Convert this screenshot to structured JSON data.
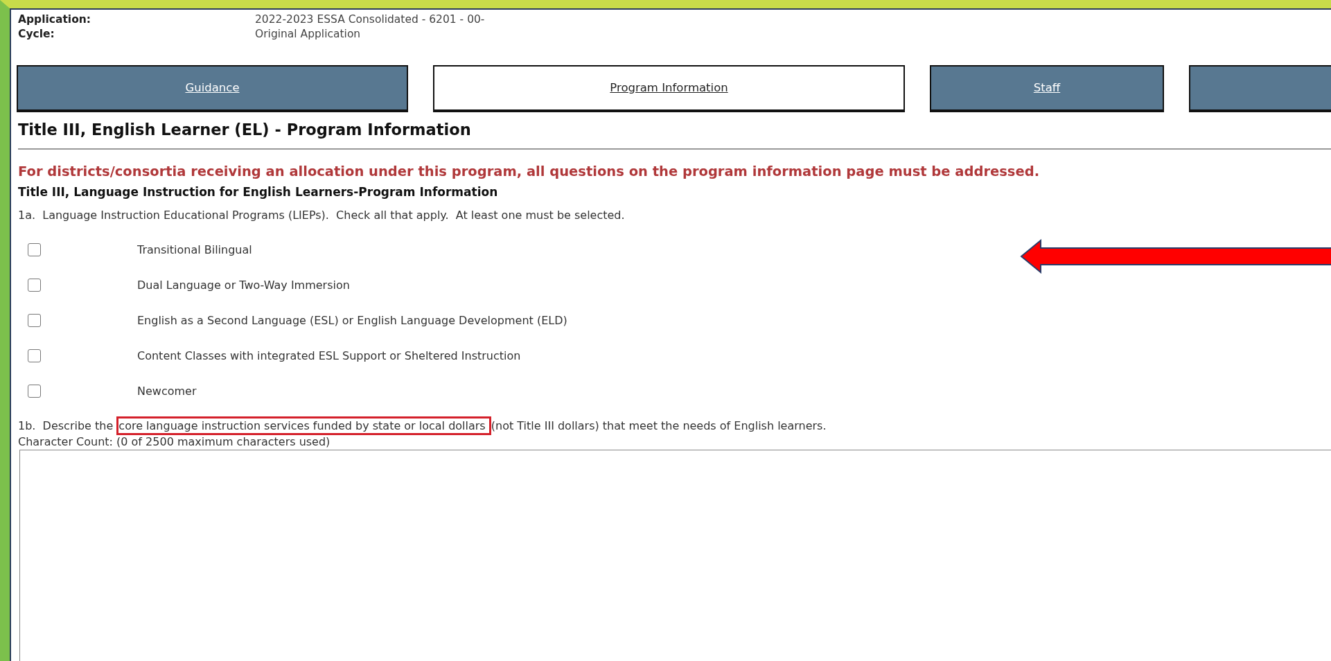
{
  "header": {
    "fields": [
      {
        "label": "Application:",
        "value": "2022-2023 ESSA Consolidated - 6201 - 00-"
      },
      {
        "label": "Cycle:",
        "value": "Original Application"
      }
    ]
  },
  "tabs": [
    {
      "label": "Guidance",
      "selected": false
    },
    {
      "label": "Program Information",
      "selected": true
    },
    {
      "label": "Staff",
      "selected": false
    },
    {
      "selected": false
    }
  ],
  "page_title": "Title III, English Learner (EL) - Program Information",
  "notice": "For districts/consortia receiving an allocation under this program, all questions on the program information page must be addressed.",
  "section_title": "Title III, Language Instruction for English Learners-Program Information",
  "question_1a": {
    "prompt": "1a.  Language Instruction Educational Programs (LIEPs).  Check all that apply.  At least one must be selected.",
    "arrow": true,
    "options": [
      {
        "label": "Transitional Bilingual",
        "checked": false
      },
      {
        "label": "Dual Language or Two-Way Immersion",
        "checked": false
      },
      {
        "label": "English as a Second Language (ESL) or English Language Development (ELD)",
        "checked": false
      },
      {
        "label": "Content Classes with integrated ESL Support or Sheltered Instruction",
        "checked": false
      },
      {
        "label": "Newcomer",
        "checked": false
      }
    ]
  },
  "question_1b": {
    "prompt_before": "1b.  Describe the ",
    "prompt_highlighted": "core language instruction services funded by state or local dollars ",
    "prompt_after": "(not Title III dollars) that meet the needs of English learners.",
    "character_count": "Character Count: (0 of 2500 maximum characters used)"
  }
}
